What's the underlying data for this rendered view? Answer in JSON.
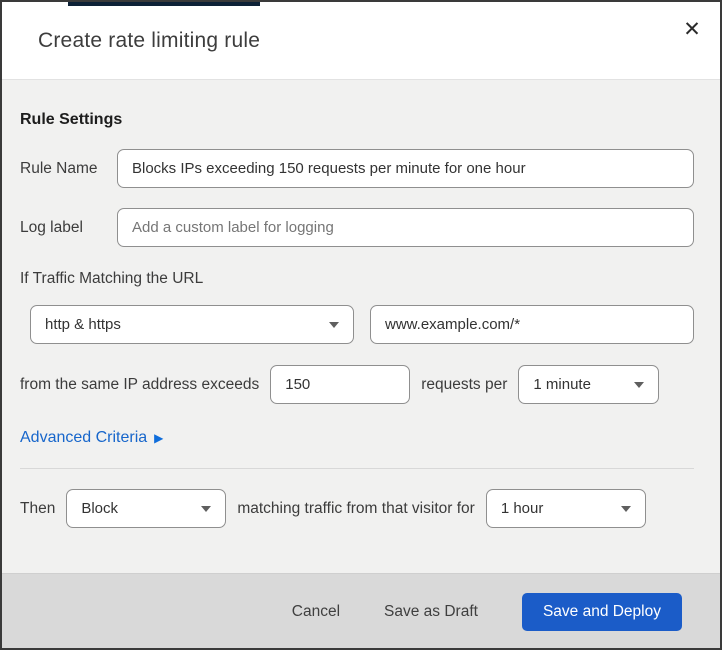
{
  "dialog": {
    "title": "Create rate limiting rule",
    "close_glyph": "✕"
  },
  "form": {
    "section_heading": "Rule Settings",
    "rule_name": {
      "label": "Rule Name",
      "value": "Blocks IPs exceeding 150 requests per minute for one hour"
    },
    "log_label": {
      "label": "Log label",
      "placeholder": "Add a custom label for logging"
    },
    "traffic_match_heading": "If Traffic Matching the URL",
    "scheme_select": {
      "value": "http & https"
    },
    "url_input": {
      "value": "www.example.com/*"
    },
    "rate_sentence": {
      "prefix": "from the same IP address exceeds",
      "requests_value": "150",
      "middle": "requests per",
      "period_value": "1 minute"
    },
    "advanced_criteria": {
      "label": "Advanced Criteria",
      "arrow": "▶"
    },
    "then_sentence": {
      "prefix": "Then",
      "action_value": "Block",
      "middle": "matching traffic from that visitor for",
      "duration_value": "1 hour"
    }
  },
  "footer": {
    "cancel_label": "Cancel",
    "save_draft_label": "Save as Draft",
    "save_deploy_label": "Save and Deploy"
  },
  "colors": {
    "primary_button": "#1b5cc8",
    "link": "#1766cb",
    "body_bg": "#f1f1f0",
    "footer_bg": "#d9d9d9",
    "top_accent_bar": "#0d2137"
  }
}
